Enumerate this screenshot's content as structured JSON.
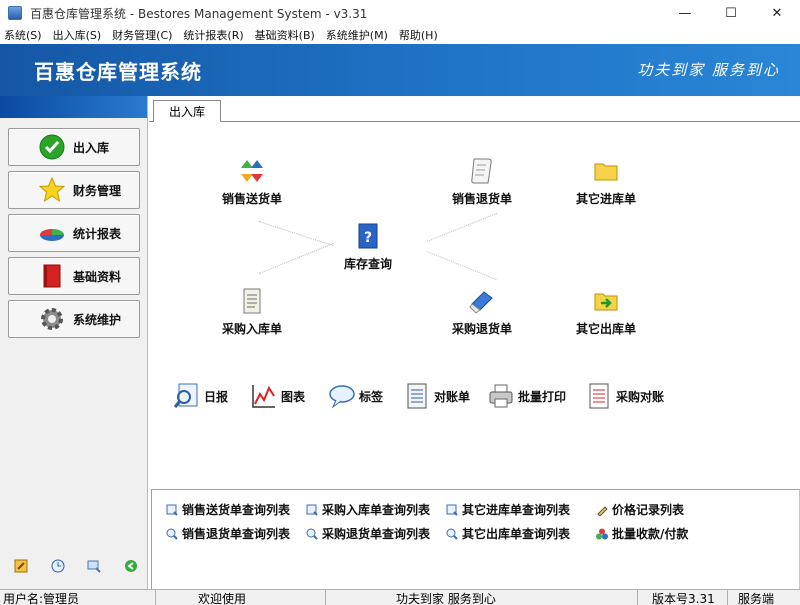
{
  "window": {
    "title": "百惠仓库管理系统 - Bestores Management System - v3.31",
    "controls": [
      "—",
      "☐",
      "✕"
    ]
  },
  "menu": [
    "系统(S)",
    "出入库(S)",
    "财务管理(C)",
    "统计报表(R)",
    "基础资料(B)",
    "系统维护(M)",
    "帮助(H)"
  ],
  "banner": {
    "title": "百惠仓库管理系统",
    "slogan": "功夫到家 服务到心"
  },
  "sidebar": {
    "items": [
      {
        "label": "出入库",
        "icon": "check-circle-icon"
      },
      {
        "label": "财务管理",
        "icon": "star-icon"
      },
      {
        "label": "统计报表",
        "icon": "pie-chart-icon"
      },
      {
        "label": "基础资料",
        "icon": "red-book-icon"
      },
      {
        "label": "系统维护",
        "icon": "gear-icon"
      }
    ],
    "tools": [
      "edit-icon",
      "clock-icon",
      "magnifier-icon",
      "back-arrow-icon"
    ]
  },
  "tab": {
    "label": "出入库"
  },
  "flow": {
    "sales_delivery": "销售送货单",
    "sales_return": "销售退货单",
    "other_in": "其它进库单",
    "inventory_query": "库存查询",
    "purchase_in": "采购入库单",
    "purchase_return": "采购退货单",
    "other_out": "其它出库单"
  },
  "tools": {
    "daily": "日报",
    "chart": "图表",
    "label": "标签",
    "statement": "对账单",
    "batch_print": "批量打印",
    "purchase_reconcile": "采购对账"
  },
  "query_links": {
    "row1": [
      "销售送货单查询列表",
      "采购入库单查询列表",
      "其它进库单查询列表",
      "价格记录列表"
    ],
    "row2": [
      "销售退货单查询列表",
      "采购退货单查询列表",
      "其它出库单查询列表",
      "批量收款/付款"
    ]
  },
  "statusbar": {
    "user": "用户名:管理员",
    "welcome": "欢迎使用",
    "slogan": "功夫到家 服务到心",
    "version": "版本号3.31",
    "mode": "服务端"
  },
  "colors": {
    "banner_start": "#1557a6",
    "banner_end": "#2a86d6",
    "sidebar_head": "#0b4aa2"
  }
}
